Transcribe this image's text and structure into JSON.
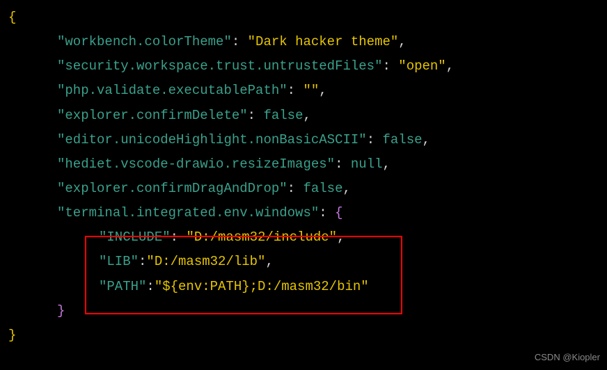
{
  "lines": [
    {
      "type": "brace-open-outer",
      "content": "{"
    },
    {
      "type": "kv",
      "key": "\"workbench.colorTheme\"",
      "sep": ": ",
      "val": "\"Dark hacker theme\"",
      "valClass": "string",
      "trail": ","
    },
    {
      "type": "kv",
      "key": "\"security.workspace.trust.untrustedFiles\"",
      "sep": ": ",
      "val": "\"open\"",
      "valClass": "string",
      "trail": ","
    },
    {
      "type": "kv",
      "key": "\"php.validate.executablePath\"",
      "sep": ": ",
      "val": "\"\"",
      "valClass": "string",
      "trail": ","
    },
    {
      "type": "kv",
      "key": "\"explorer.confirmDelete\"",
      "sep": ": ",
      "val": "false",
      "valClass": "keyword",
      "trail": ","
    },
    {
      "type": "kv",
      "key": "\"editor.unicodeHighlight.nonBasicASCII\"",
      "sep": ": ",
      "val": "false",
      "valClass": "keyword",
      "trail": ","
    },
    {
      "type": "kv",
      "key": "\"hediet.vscode-drawio.resizeImages\"",
      "sep": ": ",
      "val": "null",
      "valClass": "keyword",
      "trail": ","
    },
    {
      "type": "kv",
      "key": "\"explorer.confirmDragAndDrop\"",
      "sep": ": ",
      "val": "false",
      "valClass": "keyword",
      "trail": ","
    },
    {
      "type": "kv-open",
      "key": "\"terminal.integrated.env.windows\"",
      "sep": ": ",
      "brace": "{"
    },
    {
      "type": "kv2",
      "key": "\"INCLUDE\"",
      "sep": ": ",
      "val": "\"D:/masm32/include\"",
      "valClass": "string",
      "trail": ","
    },
    {
      "type": "kv2",
      "key": "\"LIB\"",
      "sep": ":",
      "val": "\"D:/masm32/lib\"",
      "valClass": "string",
      "trail": ","
    },
    {
      "type": "kv2",
      "key": "\"PATH\"",
      "sep": ":",
      "val": "\"${env:PATH};D:/masm32/bin\"",
      "valClass": "string",
      "trail": ""
    },
    {
      "type": "brace-close-inner",
      "content": "}"
    },
    {
      "type": "brace-close-outer",
      "content": "}"
    }
  ],
  "watermark": "CSDN @Kiopler"
}
